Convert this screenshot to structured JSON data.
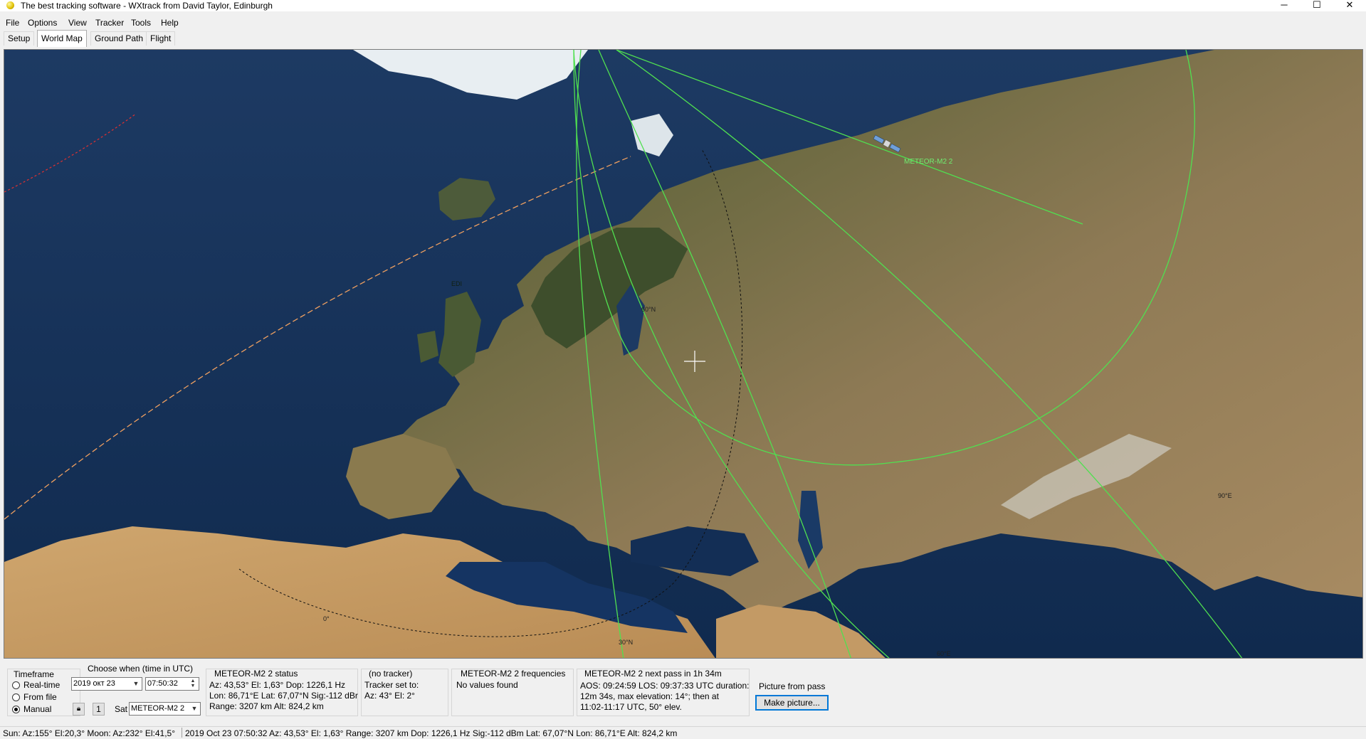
{
  "window": {
    "title": "The best tracking software - WXtrack from David Taylor, Edinburgh",
    "controls": [
      "─",
      "☐",
      "✕"
    ]
  },
  "menu": [
    "File",
    "Options",
    "View",
    "Tracker",
    "Tools",
    "Help"
  ],
  "tabs": [
    {
      "label": "Setup",
      "active": false
    },
    {
      "label": "World Map",
      "active": true
    },
    {
      "label": "Ground Path",
      "active": false
    },
    {
      "label": "Flight",
      "active": false
    }
  ],
  "map": {
    "satellite_label": "METEOR-M2 2",
    "station_label": "EDI",
    "grid_labels": {
      "lat60": "60°N",
      "lat30": "30°N",
      "lon0": "0°",
      "lon60": "60°E",
      "lon90": "90°E"
    },
    "colors": {
      "track": "#50e050",
      "terminator_orange": "#f0a060",
      "terminator_red": "#e03030"
    }
  },
  "timeframe": {
    "title": "Timeframe",
    "options": [
      {
        "label": "Real-time",
        "selected": false
      },
      {
        "label": "From file",
        "selected": false
      },
      {
        "label": "Manual",
        "selected": true
      }
    ]
  },
  "choose_when": {
    "title": "Choose when (time in UTC)",
    "date": "2019 окт  23",
    "time": "07:50:32",
    "step_button": "1",
    "sat_label": "Sat",
    "sat_value": "METEOR-M2 2"
  },
  "status": {
    "title": "METEOR-M2 2 status",
    "lines": [
      "Az: 43,53°  El: 1,63°  Dop: 1226,1 Hz",
      "Lon: 86,71°E  Lat: 67,07°N  Sig:-112 dBr",
      "Range: 3207 km  Alt: 824,2 km"
    ]
  },
  "tracker": {
    "title": "(no tracker)",
    "lines": [
      "Tracker set to:",
      "Az: 43°  El: 2°"
    ]
  },
  "frequencies": {
    "title": "METEOR-M2 2 frequencies",
    "text": "No values found"
  },
  "next_pass": {
    "title": "METEOR-M2 2 next pass in 1h 34m",
    "lines": [
      "AOS: 09:24:59  LOS: 09:37:33 UTC  duration:",
      "12m 34s,  max elevation: 14°;  then at",
      "11:02-11:17 UTC, 50° elev."
    ]
  },
  "picture": {
    "title": "Picture from pass",
    "button": "Make picture..."
  },
  "statusbar": {
    "sun_moon": "Sun: Az:155° El:20,3°   Moon: Az:232° El:41,5°",
    "details": "2019 Oct 23  07:50:32  Az: 43,53°  El: 1,63°  Range: 3207 km  Dop: 1226,1 Hz Sig:-112 dBm Lat: 67,07°N  Lon: 86,71°E  Alt: 824,2 km"
  }
}
